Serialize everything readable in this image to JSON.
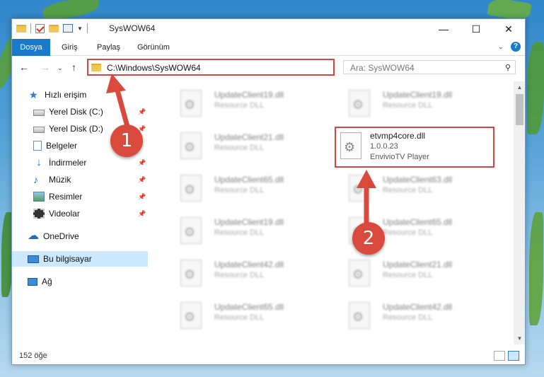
{
  "window": {
    "title": "SysWOW64"
  },
  "ribbon": {
    "tabs": [
      "Dosya",
      "Giriş",
      "Paylaş",
      "Görünüm"
    ],
    "help": "?"
  },
  "address": {
    "path": "C:\\Windows\\SysWOW64",
    "search_placeholder": "Ara: SysWOW64"
  },
  "nav_pane": {
    "items": [
      {
        "label": "Hızlı erişim"
      },
      {
        "label": "Yerel Disk (C:)"
      },
      {
        "label": "Yerel Disk (D:)"
      },
      {
        "label": "Belgeler"
      },
      {
        "label": "İndirmeler"
      },
      {
        "label": "Müzik"
      },
      {
        "label": "Resimler"
      },
      {
        "label": "Videolar"
      },
      {
        "label": "OneDrive"
      },
      {
        "label": "Bu bilgisayar"
      },
      {
        "label": "Ağ"
      }
    ],
    "selected": "Bu bilgisayar"
  },
  "files": [
    {
      "name": "UpdateClient19.dll",
      "type": "Resource DLL"
    },
    {
      "name": "UpdateClient19.dll",
      "type": "Resource DLL"
    },
    {
      "name": "UpdateClient21.dll",
      "type": "Resource DLL"
    },
    {
      "name": "UpdateClient65.dll",
      "type": "Resource DLL"
    },
    {
      "name": "UpdateClient63.dll",
      "type": "Resource DLL"
    },
    {
      "name": "UpdateClient19.dll",
      "type": "Resource DLL"
    },
    {
      "name": "UpdateClient65.dll",
      "type": "Resource DLL"
    },
    {
      "name": "UpdateClient42.dll",
      "type": "Resource DLL"
    },
    {
      "name": "UpdateClient21.dll",
      "type": "Resource DLL"
    },
    {
      "name": "UpdateClient65.dll",
      "type": "Resource DLL"
    },
    {
      "name": "UpdateClient42.dll",
      "type": "Resource DLL"
    }
  ],
  "highlighted_file": {
    "name": "etvmp4core.dll",
    "version": "1.0.0.23",
    "description": "EnvivioTV Player"
  },
  "status": {
    "count": "152 öğe"
  },
  "annotations": {
    "step1": "1",
    "step2": "2",
    "color": "#d94a3d"
  }
}
